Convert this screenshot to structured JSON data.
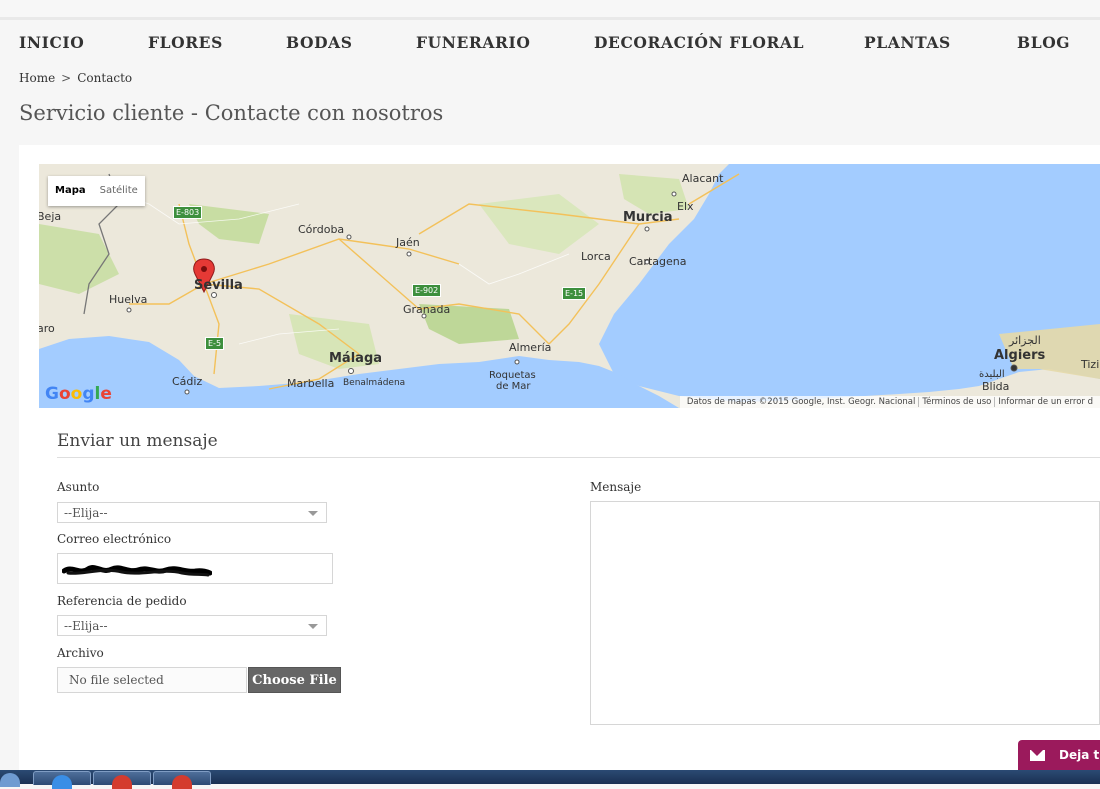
{
  "nav": {
    "items": [
      "INICIO",
      "FLORES",
      "BODAS",
      "FUNERARIO",
      "DECORACIÓN FLORAL",
      "PLANTAS",
      "BLOG"
    ]
  },
  "breadcrumb": {
    "home": "Home",
    "separator": ">",
    "current": "Contacto"
  },
  "page_title": "Servicio cliente - Contacte con nosotros",
  "map": {
    "type_toggle": {
      "map": "Mapa",
      "satellite": "Satélite"
    },
    "marker": "red-pin-icon",
    "labels": {
      "sevilla": "Sevilla",
      "huelva": "Huelva",
      "cadiz": "Cádiz",
      "cordoba": "Córdoba",
      "jaen": "Jaén",
      "granada": "Granada",
      "malaga": "Málaga",
      "marbella": "Marbella",
      "benalmadena": "Benalmádena",
      "almeria": "Almería",
      "roquetas": "Roquetas",
      "demar": "de Mar",
      "murcia": "Murcia",
      "lorca": "Lorca",
      "cartagena": "Cartagena",
      "alacant": "Alacant",
      "elx": "Elx",
      "algiers": "Algiers",
      "algiers_ar": "الجزائر",
      "blida": "Blida",
      "blida_ar": "البليدة",
      "tizi": "Tizi",
      "beja": "Beja",
      "aro": "aro"
    },
    "roads": {
      "e803": "E-803",
      "e902": "E-902",
      "e15": "E-15",
      "e5": "E-5"
    },
    "logo": "Google",
    "credit": {
      "data": "Datos de mapas ©2015 Google, Inst. Geogr. Nacional",
      "terms": "Términos de uso",
      "report": "Informar de un error d"
    }
  },
  "form": {
    "title": "Enviar un mensaje",
    "subject_label": "Asunto",
    "subject_value": "--Elija--",
    "email_label": "Correo electrónico",
    "order_label": "Referencia de pedido",
    "order_value": "--Elija--",
    "file_label": "Archivo",
    "file_status": "No file selected",
    "file_button": "Choose File",
    "message_label": "Mensaje"
  },
  "feedback_button": {
    "label": "Deja t"
  },
  "colors": {
    "accent": "#9b1a5c",
    "water": "#a3ccff",
    "land": "#e8e4d6"
  }
}
